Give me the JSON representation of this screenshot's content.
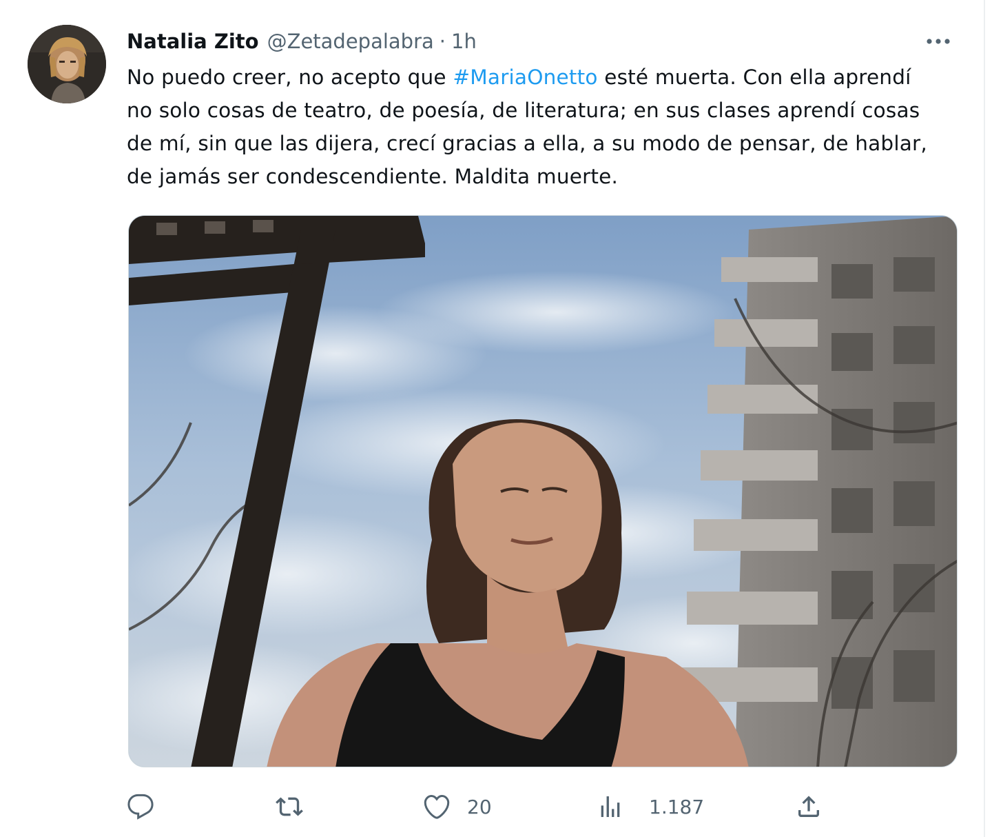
{
  "author": {
    "name": "Natalia Zito",
    "handle": "@Zetadepalabra",
    "separator": "·",
    "time": "1h"
  },
  "tweet": {
    "line1_before": "No puedo creer, no acepto que ",
    "hashtag": "#MariaOnetto",
    "line1_after": " esté muerta. Con ella aprendí",
    "line2": "no solo cosas de teatro, de poesía, de literatura; en sus clases aprendí cosas",
    "line3": "de mí, sin que las dijera, crecí gracias a ella, a su modo de pensar, de hablar,",
    "line4": "de jamás ser condescendiente. Maldita muerte."
  },
  "actions": {
    "reply": {
      "icon": "reply-icon"
    },
    "retweet": {
      "icon": "retweet-icon"
    },
    "like": {
      "icon": "heart-icon",
      "count": "20"
    },
    "views": {
      "icon": "analytics-icon",
      "count": "1.187"
    },
    "share": {
      "icon": "share-icon"
    }
  },
  "colors": {
    "text": "#0f1419",
    "secondary": "#536471",
    "link": "#1d9bf0"
  }
}
